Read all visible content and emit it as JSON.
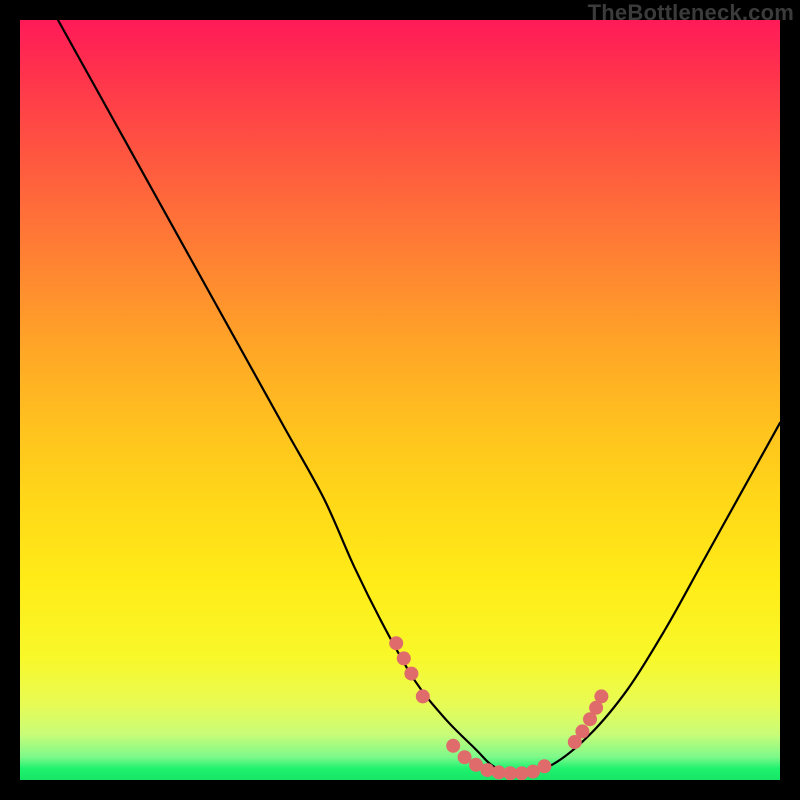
{
  "watermark": "TheBottleneck.com",
  "colors": {
    "gradient_top": "#ff1a58",
    "gradient_mid": "#ffd918",
    "gradient_bottom": "#18e566",
    "curve": "#000000",
    "marker": "#e06b6b"
  },
  "chart_data": {
    "type": "line",
    "title": "",
    "xlabel": "",
    "ylabel": "",
    "xlim": [
      0,
      100
    ],
    "ylim": [
      0,
      100
    ],
    "grid": false,
    "legend": false,
    "series": [
      {
        "name": "bottleneck-curve",
        "x": [
          5,
          10,
          15,
          20,
          25,
          30,
          35,
          40,
          44,
          48,
          52,
          56,
          60,
          62,
          64,
          66,
          70,
          75,
          80,
          85,
          90,
          95,
          100
        ],
        "y": [
          100,
          91,
          82,
          73,
          64,
          55,
          46,
          37,
          28,
          20,
          13,
          8,
          4,
          2,
          1,
          1,
          2,
          6,
          12,
          20,
          29,
          38,
          47
        ]
      }
    ],
    "markers": {
      "name": "highlight-points",
      "color": "#e06b6b",
      "points": [
        {
          "x": 49.5,
          "y": 18
        },
        {
          "x": 50.5,
          "y": 16
        },
        {
          "x": 51.5,
          "y": 14
        },
        {
          "x": 53.0,
          "y": 11
        },
        {
          "x": 57.0,
          "y": 4.5
        },
        {
          "x": 58.5,
          "y": 3.0
        },
        {
          "x": 60.0,
          "y": 2.0
        },
        {
          "x": 61.5,
          "y": 1.3
        },
        {
          "x": 63.0,
          "y": 1.0
        },
        {
          "x": 64.5,
          "y": 0.9
        },
        {
          "x": 66.0,
          "y": 0.9
        },
        {
          "x": 67.5,
          "y": 1.1
        },
        {
          "x": 69.0,
          "y": 1.8
        },
        {
          "x": 73.0,
          "y": 5.0
        },
        {
          "x": 74.0,
          "y": 6.4
        },
        {
          "x": 75.0,
          "y": 8.0
        },
        {
          "x": 75.8,
          "y": 9.5
        },
        {
          "x": 76.5,
          "y": 11.0
        }
      ]
    }
  }
}
